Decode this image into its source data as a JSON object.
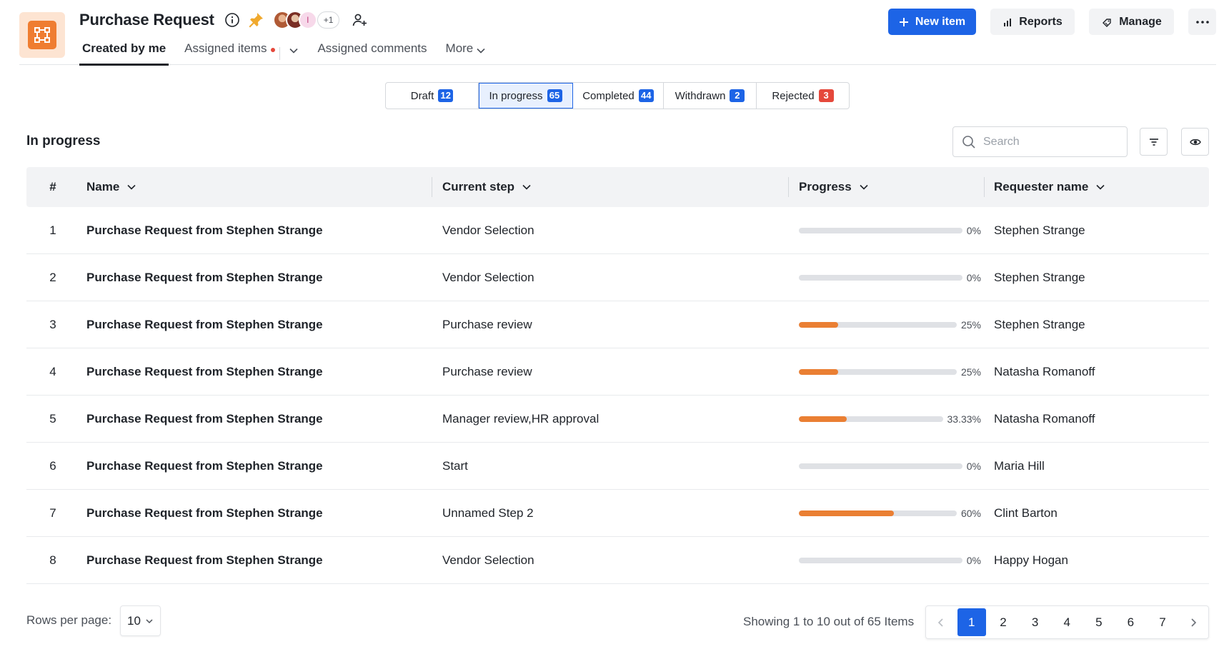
{
  "header": {
    "title": "Purchase Request",
    "avatars_more": "+1",
    "avatar_initial": "I",
    "tabs": [
      {
        "label": "Created by me"
      },
      {
        "label": "Assigned items"
      },
      {
        "label": "Assigned comments"
      },
      {
        "label": "More"
      }
    ],
    "new_item_label": "New item",
    "reports_label": "Reports",
    "manage_label": "Manage",
    "colors": {
      "primary": "#1d64e6",
      "app_icon": "#ef7d31",
      "progress": "#ea7f33"
    }
  },
  "status_tabs": [
    {
      "label": "Draft",
      "count": "12",
      "badge": "blue"
    },
    {
      "label": "In progress",
      "count": "65",
      "badge": "blue"
    },
    {
      "label": "Completed",
      "count": "44",
      "badge": "blue"
    },
    {
      "label": "Withdrawn",
      "count": "2",
      "badge": "blue"
    },
    {
      "label": "Rejected",
      "count": "3",
      "badge": "red"
    }
  ],
  "section": {
    "title": "In progress",
    "search_placeholder": "Search"
  },
  "table": {
    "columns": [
      "#",
      "Name",
      "Current step",
      "Progress",
      "Requester name"
    ],
    "rows": [
      {
        "num": "1",
        "name": "Purchase Request from Stephen Strange",
        "step": "Vendor Selection",
        "progress": 0,
        "progress_label": "0%",
        "requester": "Stephen Strange"
      },
      {
        "num": "2",
        "name": "Purchase Request from Stephen Strange",
        "step": "Vendor Selection",
        "progress": 0,
        "progress_label": "0%",
        "requester": "Stephen Strange"
      },
      {
        "num": "3",
        "name": "Purchase Request from Stephen Strange",
        "step": "Purchase review",
        "progress": 25,
        "progress_label": "25%",
        "requester": "Stephen Strange"
      },
      {
        "num": "4",
        "name": "Purchase Request from Stephen Strange",
        "step": "Purchase review",
        "progress": 25,
        "progress_label": "25%",
        "requester": "Natasha Romanoff"
      },
      {
        "num": "5",
        "name": "Purchase Request from Stephen Strange",
        "step": "Manager review,HR approval",
        "progress": 33.33,
        "progress_label": "33.33%",
        "requester": "Natasha Romanoff"
      },
      {
        "num": "6",
        "name": "Purchase Request from Stephen Strange",
        "step": "Start",
        "progress": 0,
        "progress_label": "0%",
        "requester": "Maria Hill"
      },
      {
        "num": "7",
        "name": "Purchase Request from Stephen Strange",
        "step": "Unnamed Step 2",
        "progress": 60,
        "progress_label": "60%",
        "requester": "Clint Barton"
      },
      {
        "num": "8",
        "name": "Purchase Request from Stephen Strange",
        "step": "Vendor Selection",
        "progress": 0,
        "progress_label": "0%",
        "requester": "Happy Hogan"
      }
    ]
  },
  "footer": {
    "rows_per_page_label": "Rows per page:",
    "rows_per_page_value": "10",
    "showing_text": "Showing 1 to 10 out of 65 Items",
    "pages": [
      "1",
      "2",
      "3",
      "4",
      "5",
      "6",
      "7"
    ],
    "current_page": "1"
  }
}
